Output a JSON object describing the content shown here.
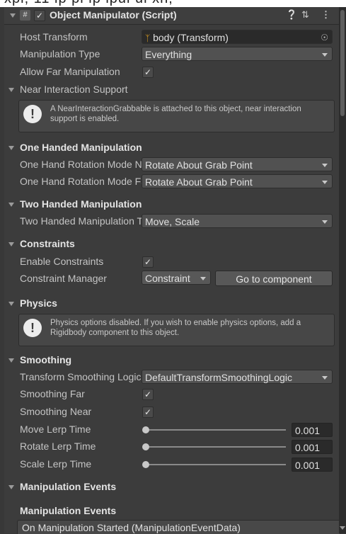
{
  "top_cut_text": "xpl, 11 ip pi ip ipul ul xn,",
  "component": {
    "title": "Object Manipulator (Script)",
    "enabled_check": "✓",
    "help_icon": "help-icon",
    "preset_icon": "preset-icon",
    "menu_icon": "kebab-menu-icon"
  },
  "fields": {
    "host_transform": {
      "label": "Host Transform",
      "value": "body (Transform)"
    },
    "manipulation_type": {
      "label": "Manipulation Type",
      "value": "Everything"
    },
    "allow_far": {
      "label": "Allow Far Manipulation",
      "checked": "✓"
    }
  },
  "near": {
    "header": "Near Interaction Support",
    "help": "A NearInteractionGrabbable is attached to this object, near interaction support is enabled."
  },
  "one_handed": {
    "header": "One Handed Manipulation",
    "rows": [
      {
        "label": "One Hand Rotation Mode Near",
        "value": "Rotate About Grab Point"
      },
      {
        "label": "One Hand Rotation Mode Far",
        "value": "Rotate About Grab Point"
      }
    ]
  },
  "two_handed": {
    "header": "Two Handed Manipulation",
    "label": "Two Handed Manipulation Type",
    "value": "Move, Scale"
  },
  "constraints": {
    "header": "Constraints",
    "enable_label": "Enable Constraints",
    "enable_checked": "✓",
    "manager_label": "Constraint Manager",
    "manager_value": "Constraint",
    "goto_button": "Go to component"
  },
  "physics": {
    "header": "Physics",
    "help": "Physics options disabled. If you wish to enable physics options, add a Rigidbody component to this object."
  },
  "smoothing": {
    "header": "Smoothing",
    "logic_label": "Transform Smoothing Logic",
    "logic_value": "DefaultTransformSmoothingLogic",
    "far_label": "Smoothing Far",
    "far_checked": "✓",
    "near_label": "Smoothing Near",
    "near_checked": "✓",
    "sliders": [
      {
        "label": "Move Lerp Time",
        "value": "0.001"
      },
      {
        "label": "Rotate Lerp Time",
        "value": "0.001"
      },
      {
        "label": "Scale Lerp Time",
        "value": "0.001"
      }
    ]
  },
  "events": {
    "header": "Manipulation Events",
    "subheader": "Manipulation Events",
    "first_event": "On Manipulation Started (ManipulationEventData)"
  }
}
